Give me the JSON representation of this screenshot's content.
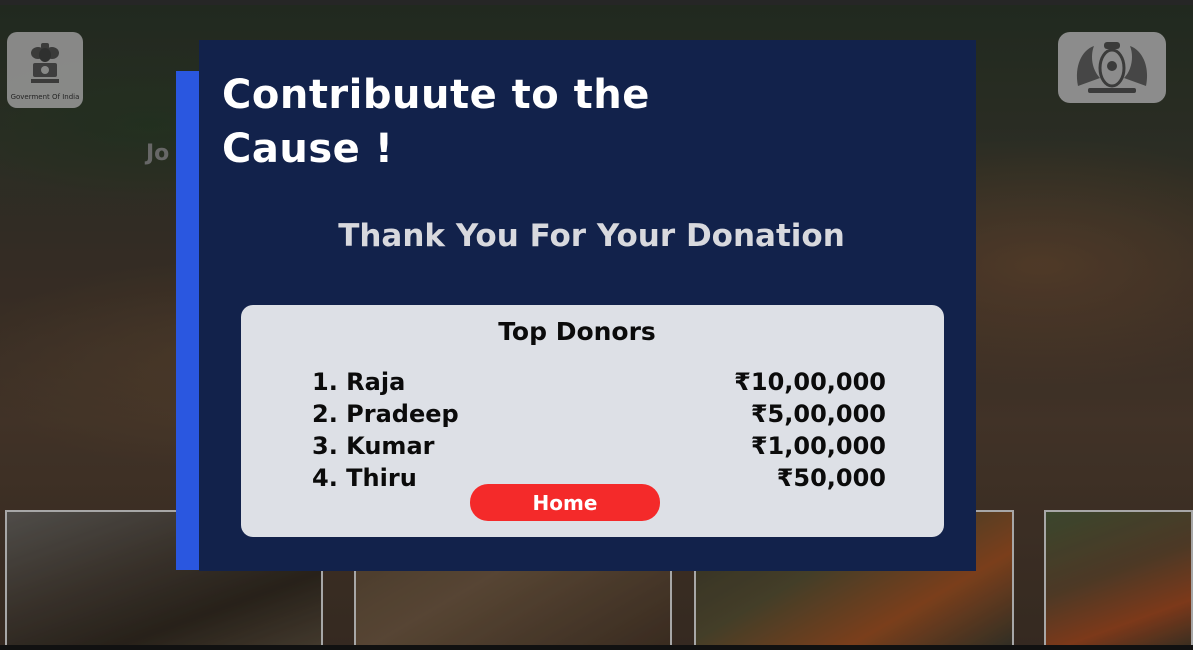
{
  "background": {
    "left_emblem_caption": "Goverment Of India",
    "partial_text": "Jo"
  },
  "modal": {
    "title_line1": "Contribuute to the",
    "title_line2": "Cause !",
    "subtitle": "Thank You For Your Donation",
    "donors_card": {
      "heading": "Top Donors",
      "donors": [
        {
          "name": "1. Raja",
          "amount": "₹10,00,000"
        },
        {
          "name": "2. Pradeep",
          "amount": "₹5,00,000"
        },
        {
          "name": "3. Kumar",
          "amount": "₹1,00,000"
        },
        {
          "name": "4. Thiru",
          "amount": "₹50,000"
        }
      ]
    },
    "home_button_label": "Home"
  },
  "colors": {
    "modal_background": "#12224b",
    "modal_accent": "#2a57e0",
    "card_background": "#dde0e6",
    "home_button": "#f42a2a"
  },
  "icons": {
    "left_emblem": "national-emblem-icon",
    "right_emblem": "state-emblem-icon"
  }
}
